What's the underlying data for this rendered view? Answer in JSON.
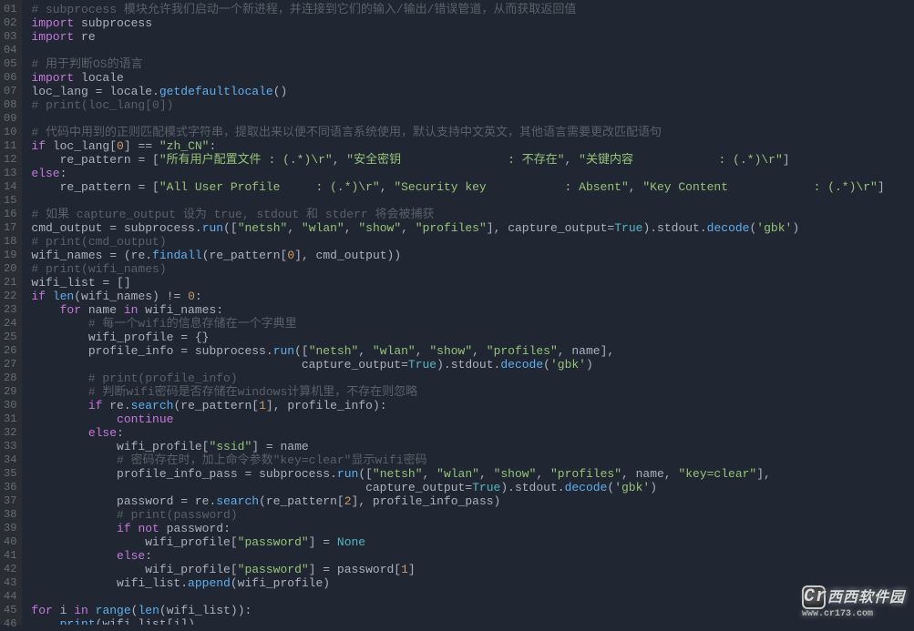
{
  "colors": {
    "bg": "#202632",
    "gutter_bg": "#2a2e33",
    "gutter_fg": "#676d73",
    "comment": "#5a6169",
    "keyword": "#c678dd",
    "string": "#98c379",
    "number": "#d19a66",
    "function": "#61afef",
    "boolean": "#56b6c2",
    "default": "#abb2bf"
  },
  "watermark": {
    "logo_text": "Cr",
    "cn": "西西",
    "en": "软件园",
    "url": "www.cr173.com"
  },
  "gutter": [
    "01",
    "02",
    "03",
    "04",
    "05",
    "06",
    "07",
    "08",
    "09",
    "10",
    "11",
    "12",
    "13",
    "14",
    "15",
    "16",
    "17",
    "18",
    "19",
    "20",
    "21",
    "22",
    "23",
    "24",
    "25",
    "26",
    "27",
    "28",
    "29",
    "30",
    "31",
    "32",
    "33",
    "34",
    "35",
    "36",
    "37",
    "38",
    "39",
    "40",
    "41",
    "42",
    "43",
    "44",
    "45",
    "46"
  ],
  "lines": [
    [
      [
        "cm",
        "# subprocess 模块允许我们启动一个新进程，并连接到它们的输入/输出/错误管道，从而获取返回值"
      ]
    ],
    [
      [
        "kw",
        "import"
      ],
      [
        "name",
        " subprocess"
      ]
    ],
    [
      [
        "kw",
        "import"
      ],
      [
        "name",
        " re"
      ]
    ],
    [],
    [
      [
        "cm",
        "# 用于判断OS的语言"
      ]
    ],
    [
      [
        "kw",
        "import"
      ],
      [
        "name",
        " locale"
      ]
    ],
    [
      [
        "name",
        "loc_lang "
      ],
      [
        "op",
        "="
      ],
      [
        "name",
        " locale"
      ],
      [
        "op",
        "."
      ],
      [
        "fn",
        "getdefaultlocale"
      ],
      [
        "op",
        "()"
      ]
    ],
    [
      [
        "cm",
        "# print(loc_lang[0])"
      ]
    ],
    [],
    [
      [
        "cm",
        "# 代码中用到的正则匹配模式字符串，提取出来以便不同语言系统使用，默认支持中文英文，其他语言需要更改匹配语句"
      ]
    ],
    [
      [
        "kw",
        "if"
      ],
      [
        "name",
        " loc_lang["
      ],
      [
        "num",
        "0"
      ],
      [
        "name",
        "] "
      ],
      [
        "op",
        "=="
      ],
      [
        "str",
        " \"zh_CN\""
      ],
      [
        "op",
        ":"
      ]
    ],
    [
      [
        "name",
        "    re_pattern "
      ],
      [
        "op",
        "="
      ],
      [
        "name",
        " ["
      ],
      [
        "str",
        "\"所有用户配置文件 : (.*)\\r\""
      ],
      [
        "op",
        ", "
      ],
      [
        "str",
        "\"安全密钥               : 不存在\""
      ],
      [
        "op",
        ", "
      ],
      [
        "str",
        "\"关键内容            : (.*)\\r\""
      ],
      [
        "name",
        "]"
      ]
    ],
    [
      [
        "kw",
        "else"
      ],
      [
        "op",
        ":"
      ]
    ],
    [
      [
        "name",
        "    re_pattern "
      ],
      [
        "op",
        "="
      ],
      [
        "name",
        " ["
      ],
      [
        "str",
        "\"All User Profile     : (.*)\\r\""
      ],
      [
        "op",
        ", "
      ],
      [
        "str",
        "\"Security key           : Absent\""
      ],
      [
        "op",
        ", "
      ],
      [
        "str",
        "\"Key Content            : (.*)\\r\""
      ],
      [
        "name",
        "]"
      ]
    ],
    [],
    [
      [
        "cm",
        "# 如果 capture_output 设为 true, stdout 和 stderr 将会被捕获"
      ]
    ],
    [
      [
        "name",
        "cmd_output "
      ],
      [
        "op",
        "="
      ],
      [
        "name",
        " subprocess"
      ],
      [
        "op",
        "."
      ],
      [
        "fn",
        "run"
      ],
      [
        "op",
        "(["
      ],
      [
        "str",
        "\"netsh\""
      ],
      [
        "op",
        ", "
      ],
      [
        "str",
        "\"wlan\""
      ],
      [
        "op",
        ", "
      ],
      [
        "str",
        "\"show\""
      ],
      [
        "op",
        ", "
      ],
      [
        "str",
        "\"profiles\""
      ],
      [
        "op",
        "], "
      ],
      [
        "name",
        "capture_output"
      ],
      [
        "op",
        "="
      ],
      [
        "bool",
        "True"
      ],
      [
        "op",
        ")."
      ],
      [
        "name",
        "stdout"
      ],
      [
        "op",
        "."
      ],
      [
        "fn",
        "decode"
      ],
      [
        "op",
        "("
      ],
      [
        "str",
        "'gbk'"
      ],
      [
        "op",
        ")"
      ]
    ],
    [
      [
        "cm",
        "# print(cmd_output)"
      ]
    ],
    [
      [
        "name",
        "wifi_names "
      ],
      [
        "op",
        "="
      ],
      [
        "name",
        " (re"
      ],
      [
        "op",
        "."
      ],
      [
        "fn",
        "findall"
      ],
      [
        "op",
        "("
      ],
      [
        "name",
        "re_pattern["
      ],
      [
        "num",
        "0"
      ],
      [
        "name",
        "], cmd_output))"
      ]
    ],
    [
      [
        "cm",
        "# print(wifi_names)"
      ]
    ],
    [
      [
        "name",
        "wifi_list "
      ],
      [
        "op",
        "="
      ],
      [
        "name",
        " []"
      ]
    ],
    [
      [
        "kw",
        "if"
      ],
      [
        "name",
        " "
      ],
      [
        "fn",
        "len"
      ],
      [
        "op",
        "("
      ],
      [
        "name",
        "wifi_names) "
      ],
      [
        "op",
        "!="
      ],
      [
        "name",
        " "
      ],
      [
        "num",
        "0"
      ],
      [
        "op",
        ":"
      ]
    ],
    [
      [
        "name",
        "    "
      ],
      [
        "kw",
        "for"
      ],
      [
        "name",
        " name "
      ],
      [
        "kw",
        "in"
      ],
      [
        "name",
        " wifi_names"
      ],
      [
        "op",
        ":"
      ]
    ],
    [
      [
        "name",
        "        "
      ],
      [
        "cm",
        "# 每一个wifi的信息存储在一个字典里"
      ]
    ],
    [
      [
        "name",
        "        wifi_profile "
      ],
      [
        "op",
        "="
      ],
      [
        "name",
        " {}"
      ]
    ],
    [
      [
        "name",
        "        profile_info "
      ],
      [
        "op",
        "="
      ],
      [
        "name",
        " subprocess"
      ],
      [
        "op",
        "."
      ],
      [
        "fn",
        "run"
      ],
      [
        "op",
        "(["
      ],
      [
        "str",
        "\"netsh\""
      ],
      [
        "op",
        ", "
      ],
      [
        "str",
        "\"wlan\""
      ],
      [
        "op",
        ", "
      ],
      [
        "str",
        "\"show\""
      ],
      [
        "op",
        ", "
      ],
      [
        "str",
        "\"profiles\""
      ],
      [
        "op",
        ", name],"
      ]
    ],
    [
      [
        "name",
        "                                      "
      ],
      [
        "name",
        "capture_output"
      ],
      [
        "op",
        "="
      ],
      [
        "bool",
        "True"
      ],
      [
        "op",
        ")."
      ],
      [
        "name",
        "stdout"
      ],
      [
        "op",
        "."
      ],
      [
        "fn",
        "decode"
      ],
      [
        "op",
        "("
      ],
      [
        "str",
        "'gbk'"
      ],
      [
        "op",
        ")"
      ]
    ],
    [
      [
        "name",
        "        "
      ],
      [
        "cm",
        "# print(profile_info)"
      ]
    ],
    [
      [
        "name",
        "        "
      ],
      [
        "cm",
        "# 判断wifi密码是否存储在windows计算机里，不存在则忽略"
      ]
    ],
    [
      [
        "name",
        "        "
      ],
      [
        "kw",
        "if"
      ],
      [
        "name",
        " re"
      ],
      [
        "op",
        "."
      ],
      [
        "fn",
        "search"
      ],
      [
        "op",
        "("
      ],
      [
        "name",
        "re_pattern["
      ],
      [
        "num",
        "1"
      ],
      [
        "name",
        "], profile_info)"
      ],
      [
        "op",
        ":"
      ]
    ],
    [
      [
        "name",
        "            "
      ],
      [
        "kw",
        "continue"
      ]
    ],
    [
      [
        "name",
        "        "
      ],
      [
        "kw",
        "else"
      ],
      [
        "op",
        ":"
      ]
    ],
    [
      [
        "name",
        "            wifi_profile["
      ],
      [
        "str",
        "\"ssid\""
      ],
      [
        "name",
        "] "
      ],
      [
        "op",
        "="
      ],
      [
        "name",
        " name"
      ]
    ],
    [
      [
        "name",
        "            "
      ],
      [
        "cm",
        "# 密码存在时，加上命令参数\"key=clear\"显示wifi密码"
      ]
    ],
    [
      [
        "name",
        "            profile_info_pass "
      ],
      [
        "op",
        "="
      ],
      [
        "name",
        " subprocess"
      ],
      [
        "op",
        "."
      ],
      [
        "fn",
        "run"
      ],
      [
        "op",
        "(["
      ],
      [
        "str",
        "\"netsh\""
      ],
      [
        "op",
        ", "
      ],
      [
        "str",
        "\"wlan\""
      ],
      [
        "op",
        ", "
      ],
      [
        "str",
        "\"show\""
      ],
      [
        "op",
        ", "
      ],
      [
        "str",
        "\"profiles\""
      ],
      [
        "op",
        ", name, "
      ],
      [
        "str",
        "\"key=clear\""
      ],
      [
        "op",
        "],"
      ]
    ],
    [
      [
        "name",
        "                                               "
      ],
      [
        "name",
        "capture_output"
      ],
      [
        "op",
        "="
      ],
      [
        "bool",
        "True"
      ],
      [
        "op",
        ")."
      ],
      [
        "name",
        "stdout"
      ],
      [
        "op",
        "."
      ],
      [
        "fn",
        "decode"
      ],
      [
        "op",
        "("
      ],
      [
        "str",
        "'gbk'"
      ],
      [
        "op",
        ")"
      ]
    ],
    [
      [
        "name",
        "            password "
      ],
      [
        "op",
        "="
      ],
      [
        "name",
        " re"
      ],
      [
        "op",
        "."
      ],
      [
        "fn",
        "search"
      ],
      [
        "op",
        "("
      ],
      [
        "name",
        "re_pattern["
      ],
      [
        "num",
        "2"
      ],
      [
        "name",
        "], profile_info_pass)"
      ]
    ],
    [
      [
        "name",
        "            "
      ],
      [
        "cm",
        "# print(password)"
      ]
    ],
    [
      [
        "name",
        "            "
      ],
      [
        "kw",
        "if"
      ],
      [
        "name",
        " "
      ],
      [
        "kw",
        "not"
      ],
      [
        "name",
        " password"
      ],
      [
        "op",
        ":"
      ]
    ],
    [
      [
        "name",
        "                wifi_profile["
      ],
      [
        "str",
        "\"password\""
      ],
      [
        "name",
        "] "
      ],
      [
        "op",
        "="
      ],
      [
        "name",
        " "
      ],
      [
        "bool",
        "None"
      ]
    ],
    [
      [
        "name",
        "            "
      ],
      [
        "kw",
        "else"
      ],
      [
        "op",
        ":"
      ]
    ],
    [
      [
        "name",
        "                wifi_profile["
      ],
      [
        "str",
        "\"password\""
      ],
      [
        "name",
        "] "
      ],
      [
        "op",
        "="
      ],
      [
        "name",
        " password["
      ],
      [
        "num",
        "1"
      ],
      [
        "name",
        "]"
      ]
    ],
    [
      [
        "name",
        "            wifi_list"
      ],
      [
        "op",
        "."
      ],
      [
        "fn",
        "append"
      ],
      [
        "op",
        "("
      ],
      [
        "name",
        "wifi_profile)"
      ]
    ],
    [],
    [
      [
        "kw",
        "for"
      ],
      [
        "name",
        " i "
      ],
      [
        "kw",
        "in"
      ],
      [
        "name",
        " "
      ],
      [
        "fn",
        "range"
      ],
      [
        "op",
        "("
      ],
      [
        "fn",
        "len"
      ],
      [
        "op",
        "("
      ],
      [
        "name",
        "wifi_list))"
      ],
      [
        "op",
        ":"
      ]
    ],
    [
      [
        "name",
        "    "
      ],
      [
        "fn",
        "print"
      ],
      [
        "op",
        "("
      ],
      [
        "name",
        "wifi_list[i])"
      ]
    ]
  ]
}
